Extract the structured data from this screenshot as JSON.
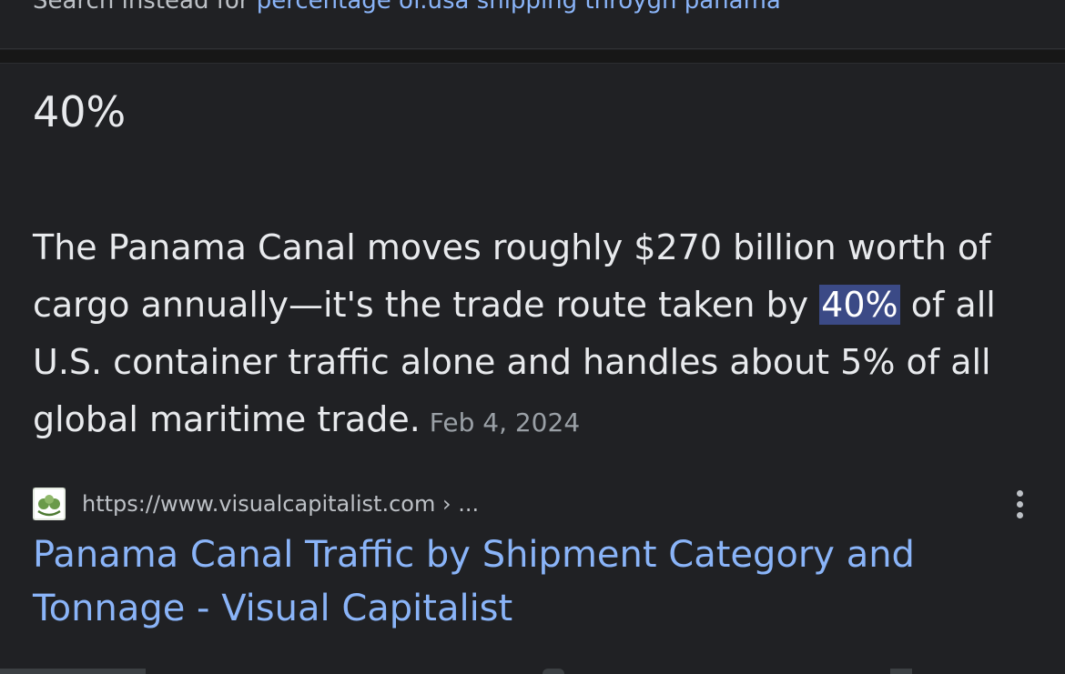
{
  "search_instead": {
    "prefix": "Search instead for ",
    "query": "percentage of.usa shipping throygh panama"
  },
  "featured_snippet": {
    "answer": "40%",
    "text_before": "The Panama Canal moves roughly $270 billion worth of cargo annually—it's the trade route taken by ",
    "highlight": "40%",
    "text_after": " of all U.S. container traffic alone and handles about 5% of all global maritime trade.",
    "date": "Feb 4, 2024"
  },
  "source": {
    "url": "https://www.visualcapitalist.com › ...",
    "favicon": "visual-capitalist-logo",
    "more_icon": "more-vert-icon"
  },
  "result": {
    "title": "Panama Canal Traffic by Shipment Category and Tonnage - Visual Capitalist"
  },
  "colors": {
    "background": "#202124",
    "text": "#e8eaed",
    "link": "#8ab4f8",
    "highlight": "#3b4a86",
    "muted": "#9aa0a6"
  }
}
